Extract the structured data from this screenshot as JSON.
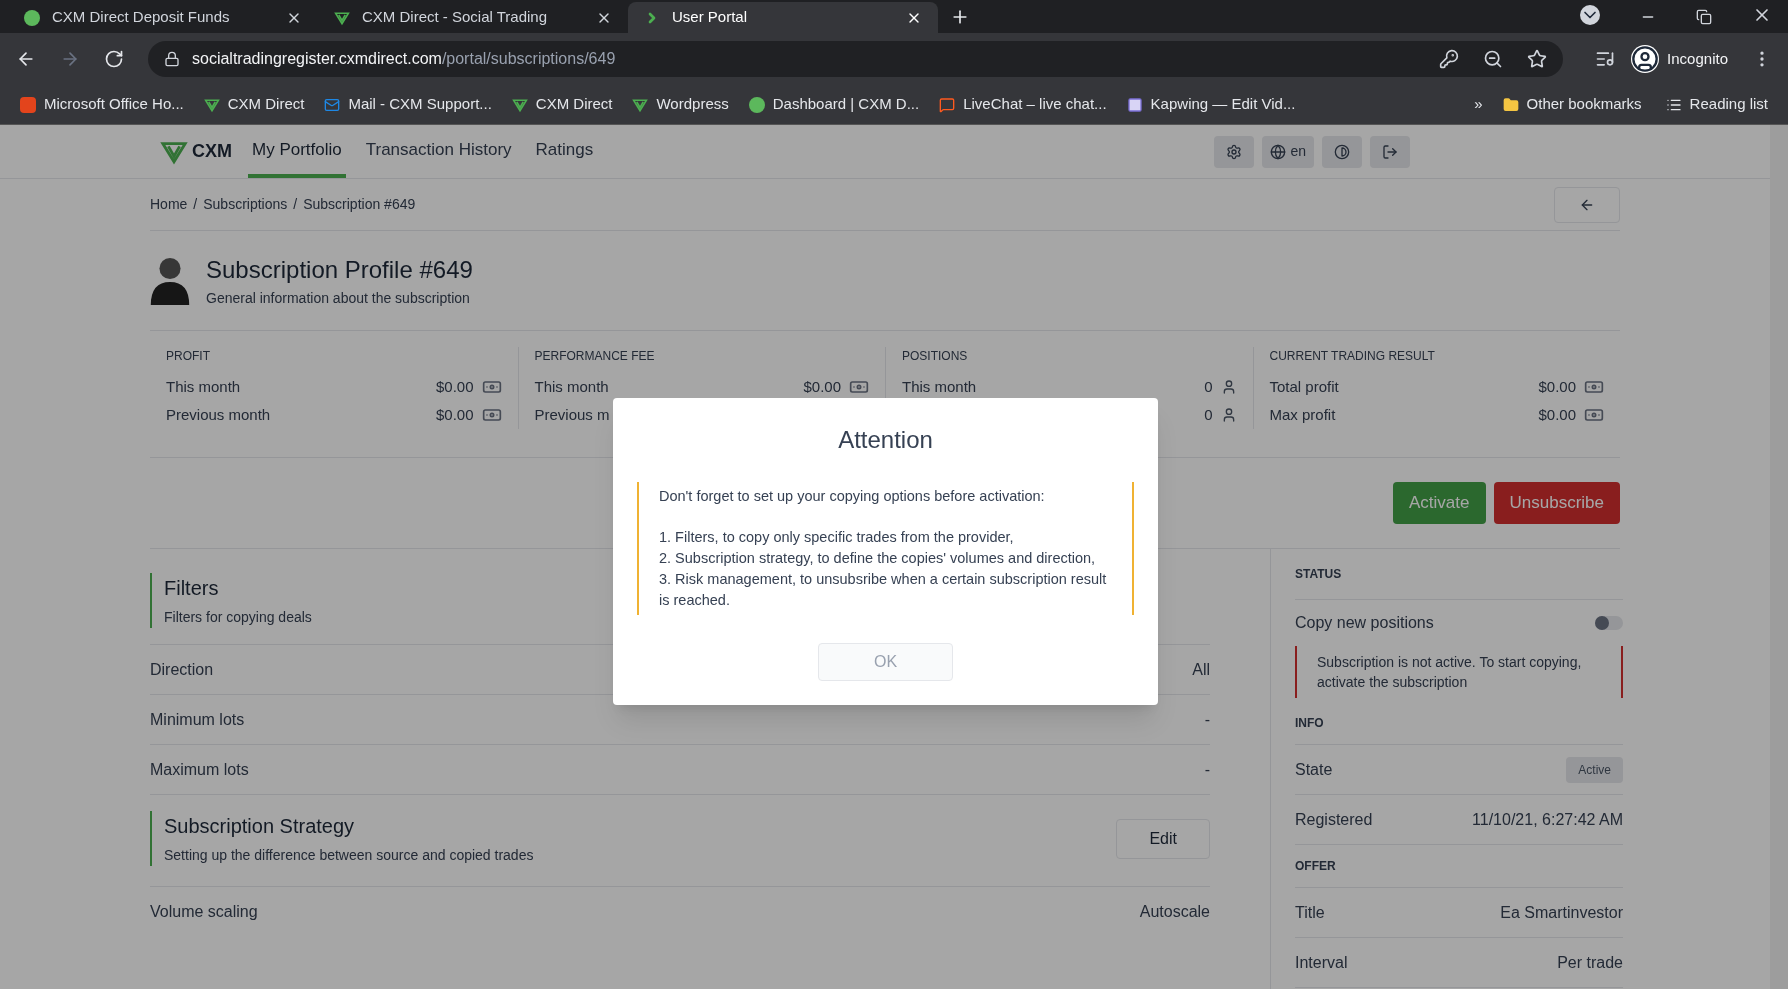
{
  "browser": {
    "tabs": [
      {
        "title": "CXM Direct Deposit Funds",
        "selected": false
      },
      {
        "title": "CXM Direct - Social Trading",
        "selected": false
      },
      {
        "title": "User Portal",
        "selected": true
      }
    ],
    "address": {
      "domain": "socialtradingregister.cxmdirect.com",
      "path": "/portal/subscriptions/649"
    },
    "profile": "Incognito",
    "bookmarks": [
      "Microsoft Office Ho...",
      "CXM Direct",
      "Mail - CXM Support...",
      "CXM Direct",
      "Wordpress",
      "Dashboard | CXM D...",
      "LiveChat – live chat...",
      "Kapwing — Edit Vid..."
    ],
    "overflow": "»",
    "other_bookmarks": "Other bookmarks",
    "reading_list": "Reading list"
  },
  "app": {
    "brand": "CXM",
    "nav": [
      {
        "label": "My Portfolio",
        "selected": true
      },
      {
        "label": "Transaction History",
        "selected": false
      },
      {
        "label": "Ratings",
        "selected": false
      }
    ],
    "language": "en",
    "breadcrumb": [
      {
        "label": "Home"
      },
      {
        "separator": "/",
        "label": "Subscriptions"
      },
      {
        "separator": "/",
        "label": "Subscription #649"
      }
    ],
    "profile": {
      "title": "Subscription Profile #649",
      "subtitle": "General information about the subscription"
    },
    "stats": [
      {
        "heading": "PROFIT",
        "rows": [
          {
            "label": "This month",
            "value": "$0.00"
          },
          {
            "label": "Previous month",
            "value": "$0.00"
          }
        ]
      },
      {
        "heading": "PERFORMANCE FEE",
        "rows": [
          {
            "label": "This month",
            "value": "$0.00"
          },
          {
            "label": "Previous m"
          }
        ]
      },
      {
        "heading": "POSITIONS",
        "rows": [
          {
            "label": "This month",
            "value": "0"
          },
          {
            "value": "0"
          }
        ]
      },
      {
        "heading": "CURRENT TRADING RESULT",
        "rows": [
          {
            "label": "Total profit",
            "value": "$0.00"
          },
          {
            "label": "Max profit",
            "value": "$0.00"
          }
        ]
      }
    ],
    "actions": [
      {
        "label": "Activate",
        "kind": "primary"
      },
      {
        "label": "Unsubscribe",
        "kind": "danger"
      }
    ],
    "filters": {
      "title": "Filters",
      "subtitle": "Filters for copying deals",
      "rows": [
        {
          "label": "Direction",
          "value": "All"
        },
        {
          "label": "Minimum lots",
          "value": "-"
        },
        {
          "label": "Maximum lots",
          "value": "-"
        }
      ]
    },
    "strategy": {
      "title": "Subscription Strategy",
      "subtitle": "Setting up the difference between source and copied trades",
      "edit": "Edit",
      "rows": [
        {
          "label": "Volume scaling",
          "value": "Autoscale"
        }
      ]
    },
    "status": {
      "heading": "STATUS",
      "copy_label": "Copy new positions",
      "copy_on": false,
      "alert": "Subscription is not active. To start copying, activate the subscription"
    },
    "info": {
      "heading": "INFO",
      "rows": [
        {
          "label": "State",
          "value": "Active",
          "kind": "badge"
        },
        {
          "label": "Registered",
          "value": "11/10/21, 6:27:42 AM",
          "kind": "text"
        }
      ]
    },
    "offer": {
      "heading": "OFFER",
      "rows": [
        {
          "label": "Title",
          "value": "Ea Smartinvestor"
        },
        {
          "label": "Interval",
          "value": "Per trade"
        }
      ]
    },
    "modal": {
      "title": "Attention",
      "intro": "Don't forget to set up your copying options before activation:",
      "items": [
        "1. Filters, to copy only specific trades from the provider,",
        "2. Subscription strategy, to define the copies' volumes and direction,",
        "3. Risk management, to unsubsribe when a certain subscription result is reached."
      ],
      "button": "OK"
    }
  }
}
